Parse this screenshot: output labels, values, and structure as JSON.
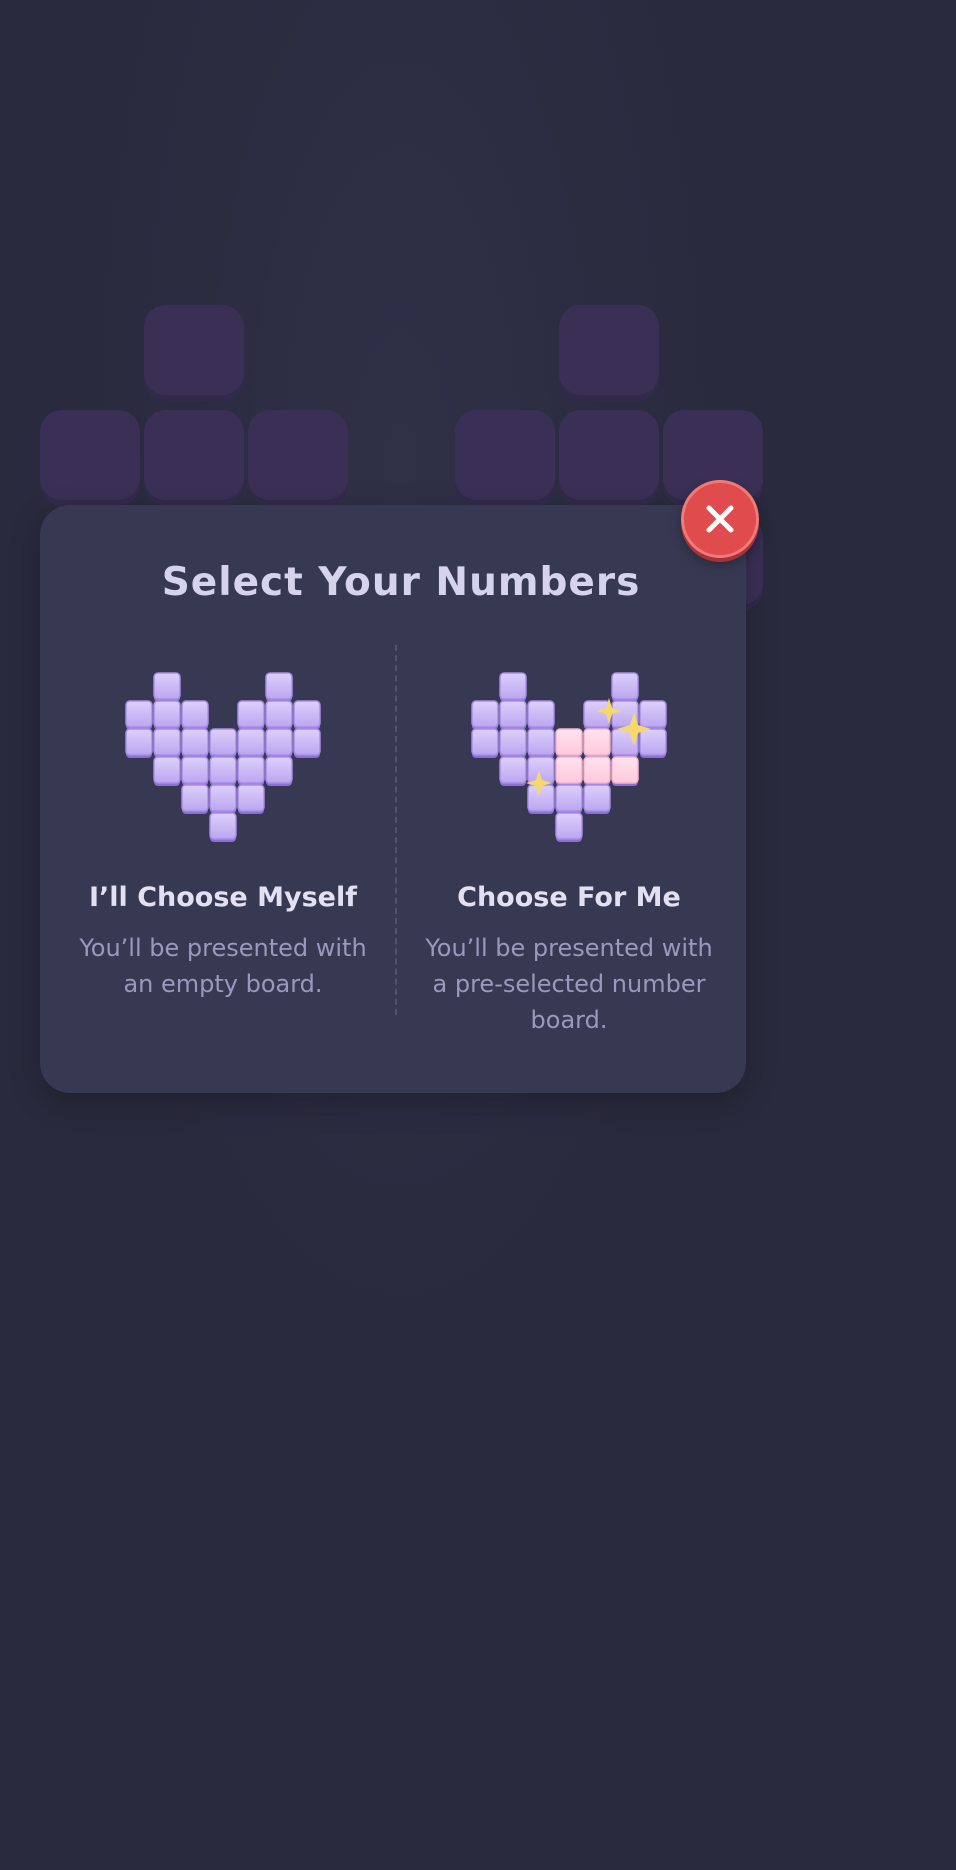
{
  "modal": {
    "title": "Select Your Numbers",
    "close_icon": "close-icon",
    "options": [
      {
        "title": "I’ll Choose Myself",
        "description": "You’ll be presented with an empty board.",
        "icon": "pixel-heart-icon"
      },
      {
        "title": "Choose For Me",
        "description": "You’ll be presented with a pre-selected number board.",
        "icon": "sparkle-pixel-heart-icon"
      }
    ]
  },
  "colors": {
    "background": "#292a3d",
    "modal": "#373952",
    "tile_purple": "#c6b3f3",
    "tile_pink": "#ffd6e6",
    "close_red": "#e04b4e",
    "sparkle": "#f5d96b"
  }
}
